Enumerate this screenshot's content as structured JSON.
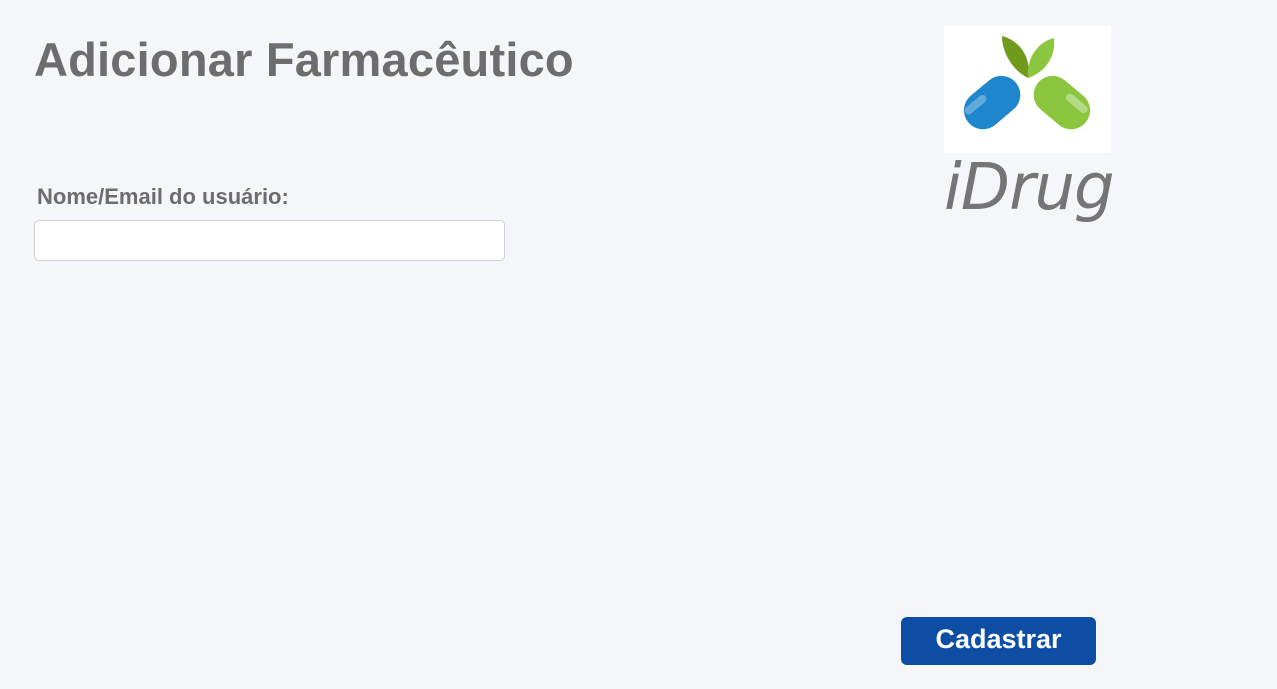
{
  "page": {
    "title": "Adicionar Farmacêutico"
  },
  "form": {
    "user_label": "Nome/Email do usuário:",
    "user_value": "",
    "user_placeholder": ""
  },
  "brand": {
    "logo_icon": "capsule-leaves-logo",
    "name": "iDrug"
  },
  "actions": {
    "submit_label": "Cadastrar"
  },
  "colors": {
    "background": "#f5f6fa",
    "text": "#6d6d6d",
    "button": "#0d4ea4",
    "capsule_blue": "#1d86cc",
    "capsule_green": "#8cc63f",
    "leaf_dark": "#6f9a1c"
  }
}
